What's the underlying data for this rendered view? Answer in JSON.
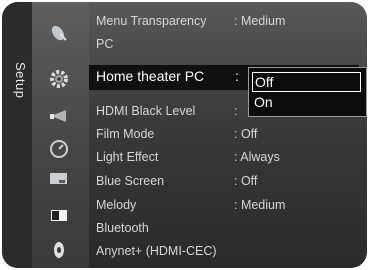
{
  "setup_tab": {
    "label": "Setup"
  },
  "category_icons": [
    "satellite-dish-icon",
    "gear-icon",
    "megaphone-icon",
    "timer-clock-icon",
    "input-connector-icon",
    "picture-icon",
    "disc-icon"
  ],
  "menu_items": [
    {
      "label": "Menu Transparency",
      "value": ": Medium"
    },
    {
      "label": "PC",
      "value": ""
    },
    {
      "label": "Home theater PC",
      "value": ":"
    },
    {
      "label": "HDMI Black Level",
      "value": ":"
    },
    {
      "label": "Film Mode",
      "value": ": Off"
    },
    {
      "label": "Light Effect",
      "value": ": Always"
    },
    {
      "label": "Blue Screen",
      "value": ": Off"
    },
    {
      "label": "Melody",
      "value": ": Medium"
    },
    {
      "label": "Bluetooth",
      "value": ""
    },
    {
      "label": "Anynet+ (HDMI-CEC)",
      "value": ""
    }
  ],
  "dropdown": {
    "options": [
      "Off",
      "On"
    ],
    "highlighted": "Off"
  }
}
